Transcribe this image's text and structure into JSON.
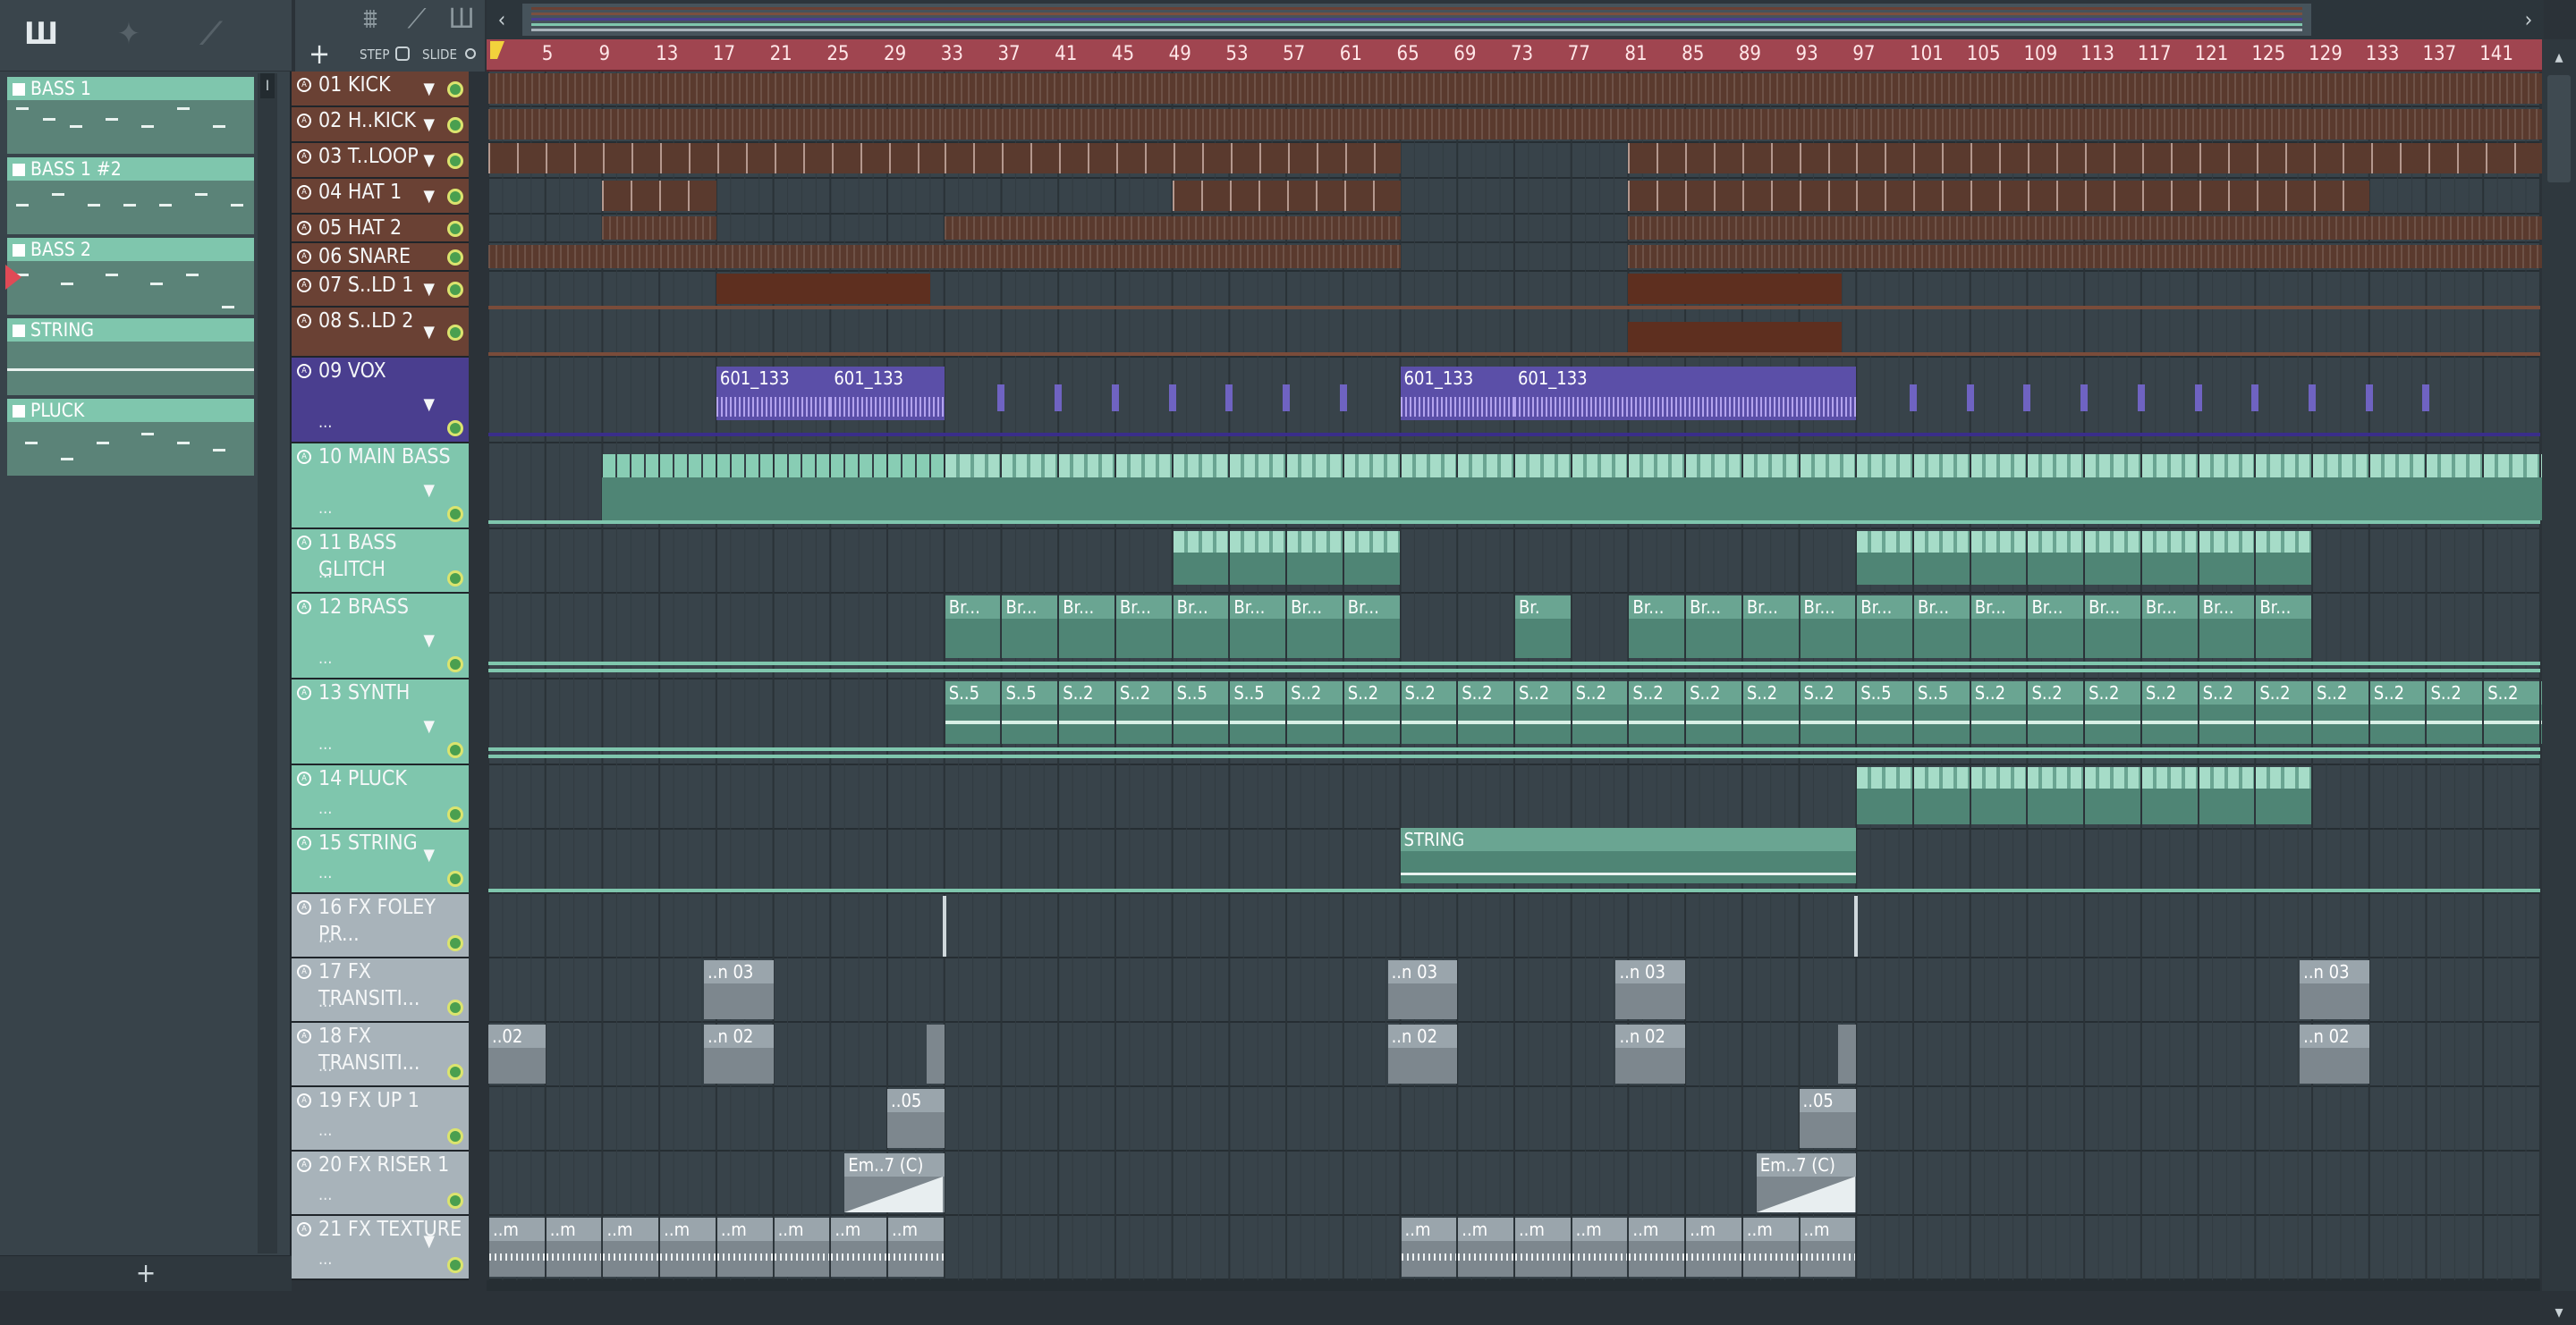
{
  "picker": {
    "patterns": [
      {
        "label": "BASS 1"
      },
      {
        "label": "BASS 1 #2"
      },
      {
        "label": "BASS 2"
      },
      {
        "label": "STRING"
      },
      {
        "label": "PLUCK"
      }
    ],
    "add_label": "+"
  },
  "playlist_toolbar": {
    "add_label": "+",
    "step_label": "STEP",
    "slide_label": "SLIDE"
  },
  "ruler": {
    "bars": [
      "5",
      "9",
      "13",
      "17",
      "21",
      "25",
      "29",
      "33",
      "37",
      "41",
      "45",
      "49",
      "53",
      "57",
      "61",
      "65",
      "69",
      "73",
      "77",
      "81",
      "85",
      "89",
      "93",
      "97",
      "101",
      "105",
      "109",
      "113",
      "117",
      "121",
      "125",
      "129",
      "133",
      "137",
      "141"
    ]
  },
  "tracks": [
    {
      "label": "01 KICK"
    },
    {
      "label": "02 H..KICK"
    },
    {
      "label": "03 T..LOOP"
    },
    {
      "label": "04 HAT 1"
    },
    {
      "label": "05 HAT 2"
    },
    {
      "label": "06 SNARE"
    },
    {
      "label": "07 S..LD 1"
    },
    {
      "label": "08 S..LD 2"
    },
    {
      "label": "09 VOX",
      "dots": "..."
    },
    {
      "label": "10 MAIN BASS",
      "dots": "..."
    },
    {
      "label": "11 BASS GLITCH",
      "dots": "..."
    },
    {
      "label": "12 BRASS",
      "dots": "..."
    },
    {
      "label": "13 SYNTH",
      "dots": "..."
    },
    {
      "label": "14 PLUCK",
      "dots": "..."
    },
    {
      "label": "15 STRING",
      "dots": "..."
    },
    {
      "label": "16 FX FOLEY PR...",
      "dots": "..."
    },
    {
      "label": "17 FX TRANSITI...",
      "dots": "..."
    },
    {
      "label": "18 FX TRANSITI...",
      "dots": "..."
    },
    {
      "label": "19 FX UP 1",
      "dots": "..."
    },
    {
      "label": "20 FX RISER 1",
      "dots": "..."
    },
    {
      "label": "21 FX TEXTURE",
      "dots": "..."
    }
  ],
  "clips": {
    "vox_a": "601_133",
    "vox_b": "601_133",
    "vox_c": "601_133",
    "vox_d": "601_133",
    "brass": "Br...",
    "brass_short": "Br.",
    "synth_a": "S..5",
    "synth_b": "S..2",
    "string": "STRING",
    "fx17": "..n 03",
    "fx18_first": "..02",
    "fx18": "..n 02",
    "fx19": "..05",
    "fx20": "Em..7 (C)",
    "fx21": "..m"
  },
  "colors": {
    "drum_track": "#6a4134",
    "vox_track": "#4a3e8f",
    "synth_track": "#7fc6ad",
    "fx_track": "#a8b3ba",
    "ruler": "#a04550",
    "led": "#4a9f4f"
  }
}
